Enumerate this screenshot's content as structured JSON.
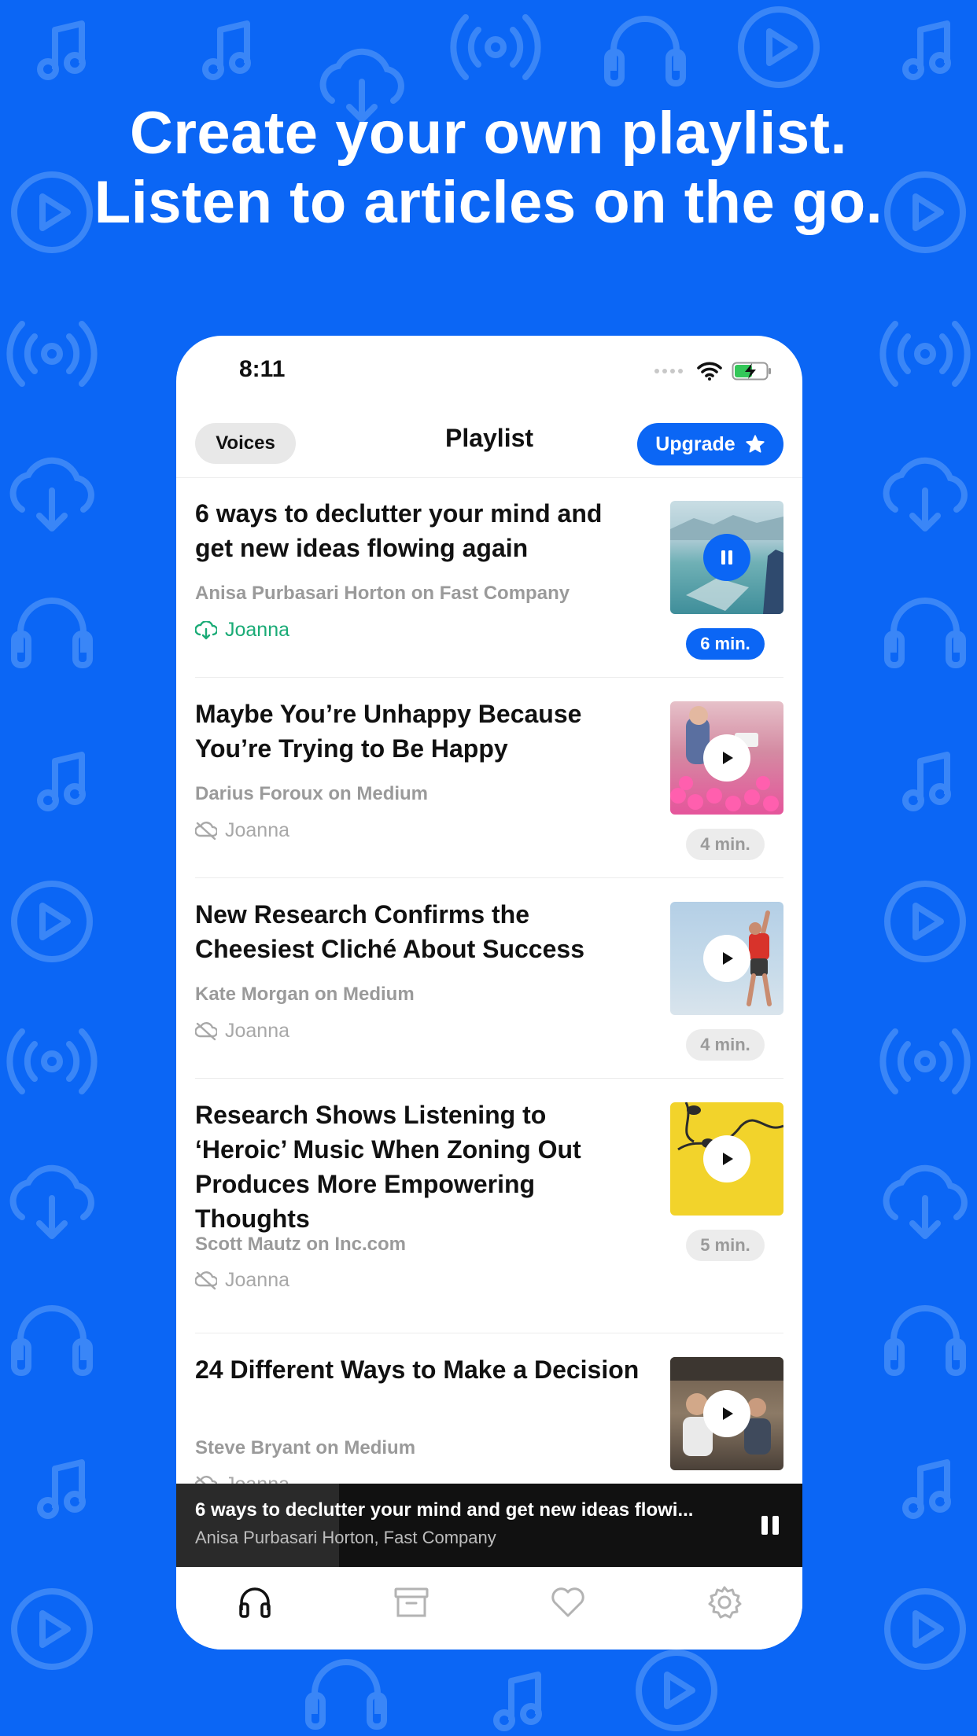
{
  "headline": {
    "line1": "Create your own playlist.",
    "line2": "Listen to articles on the go."
  },
  "colors": {
    "brand": "#0b66f5",
    "pattern": "#3a86f7",
    "voice_downloaded": "#1aab76",
    "muted_text": "#9a9a9a"
  },
  "status_bar": {
    "time": "8:11",
    "icons": [
      "signal-icon",
      "wifi-icon",
      "battery-charging-icon"
    ]
  },
  "nav": {
    "voices_label": "Voices",
    "title": "Playlist",
    "upgrade_label": "Upgrade",
    "upgrade_icon": "star-icon"
  },
  "articles": [
    {
      "title": "6 ways to declutter your mind and get new ideas flowing again",
      "source": "Anisa Purbasari Horton on Fast Company",
      "voice": "Joanna",
      "voice_status": "downloaded",
      "duration": "6 min.",
      "state": "playing",
      "thumb": "lake-dock-image"
    },
    {
      "title": "Maybe You’re Unhappy Because You’re Trying to Be Happy",
      "source": "Darius Foroux on Medium",
      "voice": "Joanna",
      "voice_status": "not-downloaded",
      "duration": "4 min.",
      "state": "paused",
      "thumb": "pink-balls-image"
    },
    {
      "title": "New Research Confirms the Cheesiest Cliché About Success",
      "source": "Kate Morgan on Medium",
      "voice": "Joanna",
      "voice_status": "not-downloaded",
      "duration": "4 min.",
      "state": "paused",
      "thumb": "climber-image"
    },
    {
      "title": "Research Shows Listening to ‘Heroic’ Music When Zoning Out Produces More Empowering Thoughts",
      "source": "Scott Mautz on Inc.com",
      "voice": "Joanna",
      "voice_status": "not-downloaded",
      "duration": "5 min.",
      "state": "paused",
      "thumb": "earphones-image"
    },
    {
      "title": "24 Different Ways to Make a Decision",
      "source": "Steve Bryant on Medium",
      "voice": "Joanna",
      "voice_status": "not-downloaded",
      "duration": "",
      "state": "paused",
      "thumb": "office-people-image"
    }
  ],
  "mini_player": {
    "title": "6 ways to declutter your mind and get new ideas flowi...",
    "subtitle": "Anisa Purbasari Horton, Fast Company",
    "progress": 0.26
  },
  "tabs": [
    {
      "icon": "headphones-icon",
      "active": true
    },
    {
      "icon": "archive-icon",
      "active": false
    },
    {
      "icon": "heart-icon",
      "active": false
    },
    {
      "icon": "settings-gear-icon",
      "active": false
    }
  ]
}
